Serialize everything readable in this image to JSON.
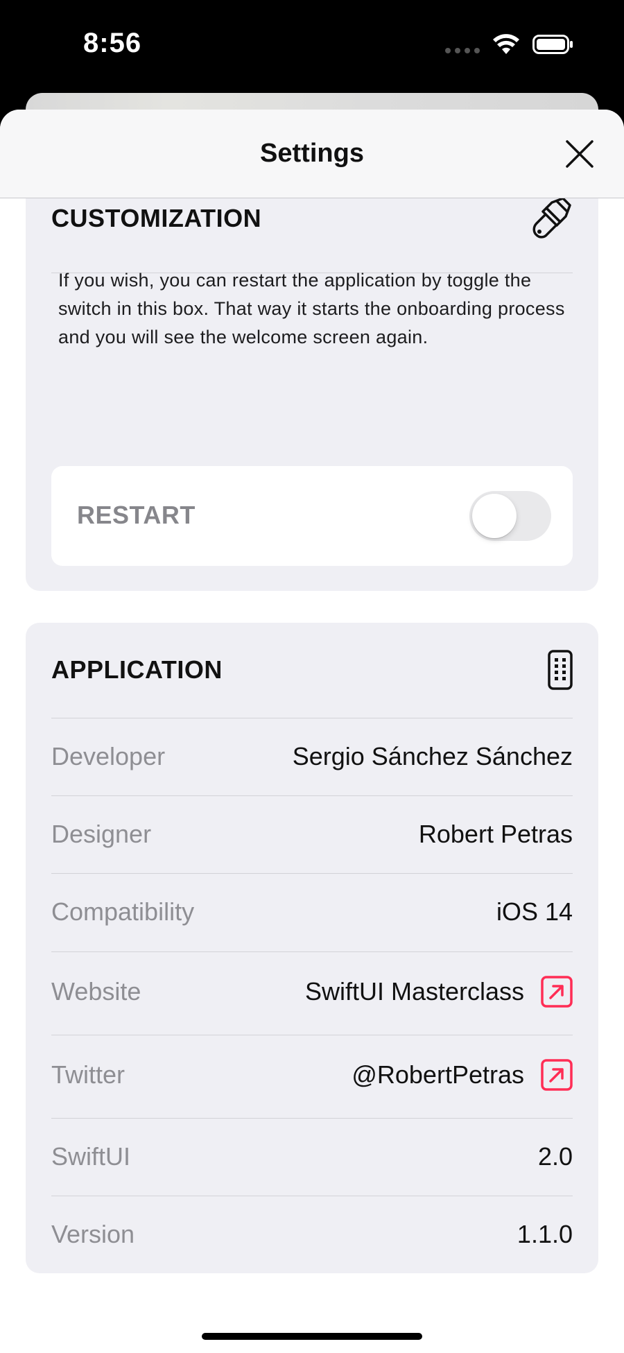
{
  "status_bar": {
    "time": "8:56"
  },
  "header": {
    "title": "Settings"
  },
  "customization": {
    "title": "CUSTOMIZATION",
    "description": "If you wish, you can restart the application by toggle the switch in this box. That way it starts the onboarding process and you will see the welcome screen again.",
    "restart_label": "RESTART",
    "restart_enabled": false
  },
  "application": {
    "title": "APPLICATION",
    "rows": [
      {
        "label": "Developer",
        "value": "Sergio Sánchez Sánchez"
      },
      {
        "label": "Designer",
        "value": "Robert Petras"
      },
      {
        "label": "Compatibility",
        "value": "iOS 14"
      },
      {
        "label": "Website",
        "value": "SwiftUI Masterclass"
      },
      {
        "label": "Twitter",
        "value": "@RobertPetras"
      },
      {
        "label": "SwiftUI",
        "value": "2.0"
      },
      {
        "label": "Version",
        "value": "1.1.0"
      }
    ]
  },
  "colors": {
    "link_accent": "#ff2d55",
    "box_background": "#efeff4"
  },
  "icons": {
    "customization": "paintbrush-icon",
    "application": "phone-device-icon",
    "link": "external-link-icon",
    "close": "close-icon"
  }
}
